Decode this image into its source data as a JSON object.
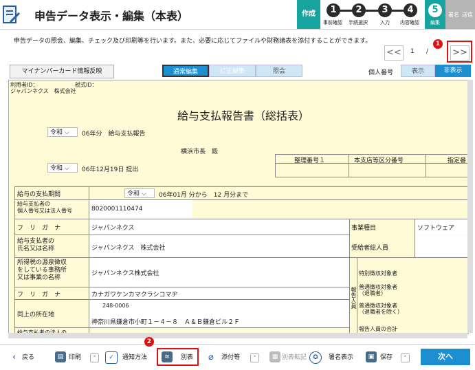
{
  "header": {
    "title": "申告データ表示・編集（本表）",
    "steps": [
      {
        "label": "作成"
      },
      {
        "num": "1",
        "label": "事前確認"
      },
      {
        "num": "2",
        "label": "手続選択"
      },
      {
        "num": "3",
        "label": "入力"
      },
      {
        "num": "4",
        "label": "内容確認"
      },
      {
        "num": "5",
        "label": "編集"
      },
      {
        "label": "署名"
      },
      {
        "label": "送信"
      }
    ]
  },
  "description": "申告データの照会、編集、チェック及び印刷等を行います。また、必要に応じてファイルや財務諸表を添付することができます。",
  "pager": {
    "prev": "<<",
    "page": "1",
    "sep": "/",
    "next": ">>"
  },
  "badges": {
    "one": "1",
    "two": "2"
  },
  "toolbar": {
    "mynumber": "マイナンバーカード情報反映",
    "mode_normal": "通常編集",
    "mode_correct": "訂正編集",
    "mode_ref": "照会",
    "personal_label": "個人番号",
    "show": "表示",
    "hide": "非表示"
  },
  "form": {
    "user_id_label": "利用者ID：",
    "tax_id_label": "税式ID：",
    "company_top": "ジャパンネクス　株式会社",
    "heading": "給与支払報告書（総括表）",
    "era1": "令和",
    "year_text": "06年分　給与支払報告",
    "mayor": "横浜市長　殿",
    "era2": "令和",
    "submit_date": "06年12月19日 提出",
    "col_seiri": "整理番号１",
    "col_branch": "本支店等区分番号",
    "col_designated": "指定番",
    "period_label": "給与の支払期間",
    "period_era": "令和",
    "period_value": "06年01月 分から　12 月分まで",
    "corp_no_label": "給与支払者の\n個人番号又は法人番号",
    "corp_no_value": "8020001110474",
    "furigana_label": "フ　リ　ガ　ナ",
    "furigana_value": "ジャパンネクス",
    "payer_name_label": "給与支払者の\n氏名又は名称",
    "payer_name_value": "ジャパンネクス　株式会社",
    "office_label": "所得税の源泉徴収\nをしている事務所\n又は事業の名称",
    "office_value": "ジャパンネクス株式会社",
    "furigana2_label": "フ　リ　ガ　ナ",
    "furigana2_value": "カナガワケンカマクラシコマヂ",
    "address_label": "同上の所在地",
    "postal": "248-0006",
    "address": "神奈川県鎌倉市小町１－４－８　Ａ＆Ｂ鎌倉ビル２Ｆ",
    "cut_label": "給与支払者の法人の",
    "business_label": "事業種目",
    "business_value": "ソフトウェア",
    "total_label": "受給者総人員",
    "report_vert": "報告人員",
    "special_label": "特別徴収対象者",
    "regular_ret_label": "普通徴収対象者\n（退職者）",
    "regular_exc_label": "普通徴収対象者\n（退職者を除く）",
    "report_total_label": "報告人員の合計"
  },
  "bottom": {
    "back": "戻る",
    "print": "印刷",
    "notice": "通知方法",
    "appendix": "別表",
    "attach": "添付等",
    "appendix_note": "別表転記",
    "signer": "署名表示",
    "save": "保存",
    "next": "次へ"
  }
}
